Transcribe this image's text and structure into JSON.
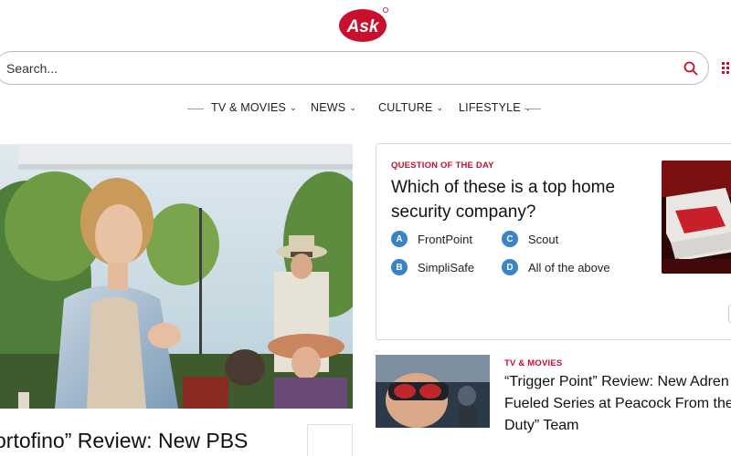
{
  "brand": {
    "logo_text": "Ask",
    "accent": "#c8102e"
  },
  "search": {
    "placeholder": "Search...",
    "value": ""
  },
  "nav": {
    "items": [
      {
        "label": "TV & MOVIES"
      },
      {
        "label": "NEWS"
      },
      {
        "label": "CULTURE"
      },
      {
        "label": "LIFESTYLE"
      }
    ]
  },
  "hero": {
    "title": "ortofino” Review: New PBS"
  },
  "qotd": {
    "label": "QUESTION OF THE DAY",
    "question": "Which of these is a top home security company?",
    "answers": [
      {
        "letter": "A",
        "text": "FrontPoint"
      },
      {
        "letter": "B",
        "text": "SimpliSafe"
      },
      {
        "letter": "C",
        "text": "Scout"
      },
      {
        "letter": "D",
        "text": "All of the above"
      }
    ],
    "answer_badge_color": "#3a83c4"
  },
  "card2": {
    "category": "TV & MOVIES",
    "title_lines": [
      "“Trigger Point” Review: New Adren",
      "Fueled Series at Peacock From the",
      "Duty” Team"
    ]
  },
  "icons": {
    "search": "search-icon",
    "apps": "apps-grid-icon",
    "chevron": "chevron-down-icon"
  }
}
